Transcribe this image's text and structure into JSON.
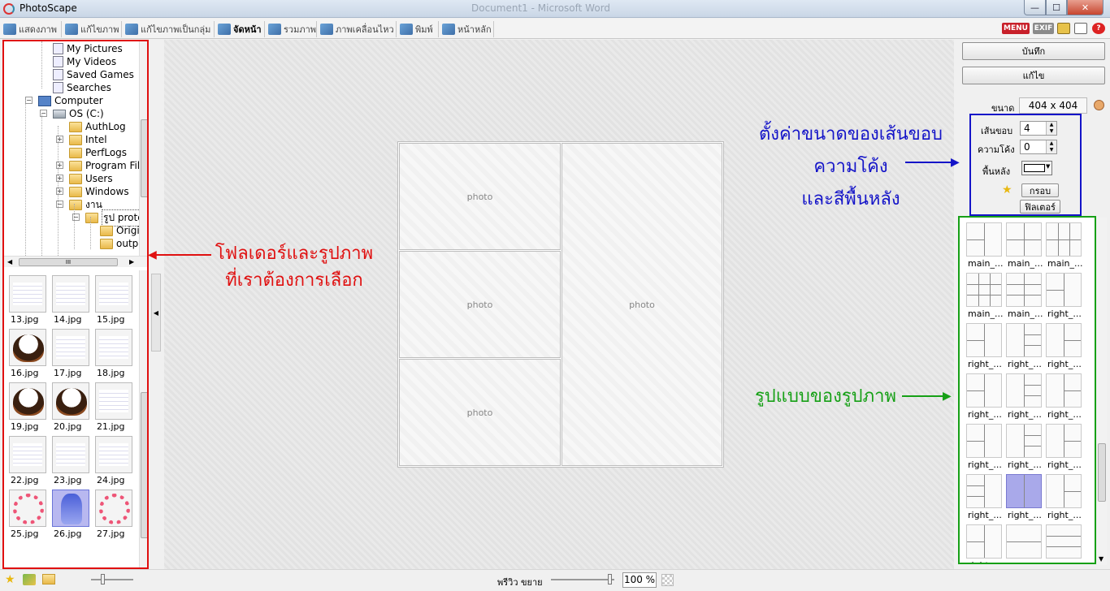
{
  "app": {
    "title": "PhotoScape",
    "background_window_title": "Document1 - Microsoft Word"
  },
  "window_controls": {
    "minimize": "—",
    "maximize": "☐",
    "close": "✕"
  },
  "tabs": [
    {
      "label": "แสดงภาพ",
      "icon": "viewer-icon"
    },
    {
      "label": "แก้ไขภาพ",
      "icon": "editor-icon"
    },
    {
      "label": "แก้ไขภาพเป็นกลุ่ม",
      "icon": "batch-editor-icon"
    },
    {
      "label": "จัดหน้า",
      "icon": "page-icon",
      "active": true
    },
    {
      "label": "รวมภาพ",
      "icon": "combine-icon"
    },
    {
      "label": "ภาพเคลื่อนไหว",
      "icon": "animated-gif-icon"
    },
    {
      "label": "พิมพ์",
      "icon": "print-icon"
    },
    {
      "label": "หน้าหลัก",
      "icon": "home-icon"
    }
  ],
  "top_right_icons": {
    "menu": "MENU",
    "exif": "EXIF"
  },
  "tree": [
    {
      "label": "My Pictures",
      "icon": "doc"
    },
    {
      "label": "My Videos",
      "icon": "doc"
    },
    {
      "label": "Saved Games",
      "icon": "doc"
    },
    {
      "label": "Searches",
      "icon": "doc"
    },
    {
      "label": "Computer",
      "icon": "pc",
      "expander": "−"
    },
    {
      "label": "OS (C:)",
      "icon": "drive",
      "expander": "−"
    },
    {
      "label": "AuthLog",
      "icon": "folder"
    },
    {
      "label": "Intel",
      "icon": "folder",
      "expander": "+"
    },
    {
      "label": "PerfLogs",
      "icon": "folder"
    },
    {
      "label": "Program Files",
      "icon": "folder",
      "expander": "+"
    },
    {
      "label": "Users",
      "icon": "folder",
      "expander": "+"
    },
    {
      "label": "Windows",
      "icon": "folder",
      "expander": "+"
    },
    {
      "label": "งาน",
      "icon": "folder",
      "expander": "−"
    },
    {
      "label": "รูป proto",
      "icon": "folder",
      "expander": "−"
    },
    {
      "label": "Origi",
      "icon": "folder"
    },
    {
      "label": "outp",
      "icon": "folder"
    }
  ],
  "tree_hscroll_thumb": "III",
  "thumbnails": [
    {
      "name": "13.jpg",
      "kind": "doc"
    },
    {
      "name": "14.jpg",
      "kind": "doc"
    },
    {
      "name": "15.jpg",
      "kind": "doc"
    },
    {
      "name": "16.jpg",
      "kind": "cake"
    },
    {
      "name": "17.jpg",
      "kind": "doc"
    },
    {
      "name": "18.jpg",
      "kind": "doc"
    },
    {
      "name": "19.jpg",
      "kind": "cake"
    },
    {
      "name": "20.jpg",
      "kind": "cake"
    },
    {
      "name": "21.jpg",
      "kind": "doc"
    },
    {
      "name": "22.jpg",
      "kind": "doc"
    },
    {
      "name": "23.jpg",
      "kind": "doc"
    },
    {
      "name": "24.jpg",
      "kind": "doc"
    },
    {
      "name": "25.jpg",
      "kind": "flower"
    },
    {
      "name": "26.jpg",
      "kind": "anime",
      "selected": true
    },
    {
      "name": "27.jpg",
      "kind": "flower"
    }
  ],
  "canvas": {
    "cell_label": "photo"
  },
  "right_panel": {
    "save_label": "บันทึก",
    "edit_label": "แก้ไข",
    "size_label": "ขนาด",
    "size_value": "404 x 404",
    "border_label": "เส้นขอบ",
    "border_value": "4",
    "round_label": "ความโค้ง",
    "round_value": "0",
    "background_label": "พื้นหลัง",
    "frame_button": "กรอบ",
    "filter_button": "ฟิลเตอร์",
    "background_color": "#ffffff"
  },
  "layouts": [
    {
      "label": "main_..."
    },
    {
      "label": "main_..."
    },
    {
      "label": "main_..."
    },
    {
      "label": "main_..."
    },
    {
      "label": "main_..."
    },
    {
      "label": "right_..."
    },
    {
      "label": "right_..."
    },
    {
      "label": "right_..."
    },
    {
      "label": "right_..."
    },
    {
      "label": "right_..."
    },
    {
      "label": "right_..."
    },
    {
      "label": "right_..."
    },
    {
      "label": "right_..."
    },
    {
      "label": "right_..."
    },
    {
      "label": "right_..."
    },
    {
      "label": "right_..."
    },
    {
      "label": "right_...",
      "selected": true
    },
    {
      "label": "right_..."
    },
    {
      "label": "right_..."
    },
    {
      "label": "squar..."
    },
    {
      "label": "squar..."
    }
  ],
  "annotations": {
    "left_line1": "โฟลเดอร์และรูปภาพ",
    "left_line2": "ที่เราต้องการเลือก",
    "settings_line1": "ตั้งค่าขนาดของเส้นขอบ",
    "settings_line2": "ความโค้ง",
    "settings_line3": "และสีพื้นหลัง",
    "layouts_line": "รูปแบบของรูปภาพ",
    "colors": {
      "red": "#e01010",
      "blue": "#1414c8",
      "green": "#16a016"
    }
  },
  "bottom": {
    "preview_label": "พรีวิว ขยาย",
    "zoom_value": "100 %"
  }
}
